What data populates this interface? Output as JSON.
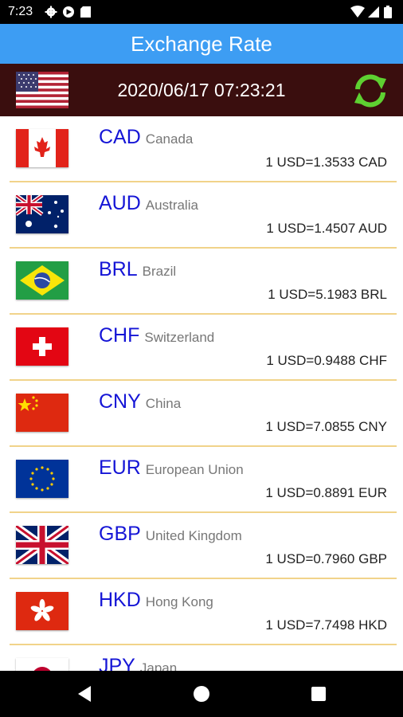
{
  "status_bar": {
    "time": "7:23",
    "icons_left": [
      "gear-icon",
      "play-icon",
      "sd-card-icon"
    ],
    "icons_right": [
      "wifi-icon",
      "signal-icon",
      "battery-icon"
    ]
  },
  "app_bar": {
    "title": "Exchange Rate"
  },
  "header": {
    "base_flag": "us-flag-icon",
    "timestamp": "2020/06/17 07:23:21",
    "refresh_icon": "refresh-icon",
    "refresh_color": "#5ed131"
  },
  "rates": [
    {
      "code": "CAD",
      "country": "Canada",
      "rate": "1 USD=1.3533 CAD"
    },
    {
      "code": "AUD",
      "country": "Australia",
      "rate": "1 USD=1.4507 AUD"
    },
    {
      "code": "BRL",
      "country": "Brazil",
      "rate": "1 USD=5.1983 BRL"
    },
    {
      "code": "CHF",
      "country": "Switzerland",
      "rate": "1 USD=0.9488 CHF"
    },
    {
      "code": "CNY",
      "country": "China",
      "rate": "1 USD=7.0855 CNY"
    },
    {
      "code": "EUR",
      "country": "European Union",
      "rate": "1 USD=0.8891 EUR"
    },
    {
      "code": "GBP",
      "country": "United Kingdom",
      "rate": "1 USD=0.7960 GBP"
    },
    {
      "code": "HKD",
      "country": "Hong Kong",
      "rate": "1 USD=7.7498 HKD"
    },
    {
      "code": "JPY",
      "country": "Japan",
      "rate": ""
    }
  ],
  "nav_bar": {
    "icons": [
      "back-icon",
      "home-icon",
      "recents-icon"
    ]
  },
  "colors": {
    "app_bar": "#3d9df3",
    "header": "#3a0e0e",
    "currency_code": "#1515d6",
    "divider": "#f1d38a"
  }
}
